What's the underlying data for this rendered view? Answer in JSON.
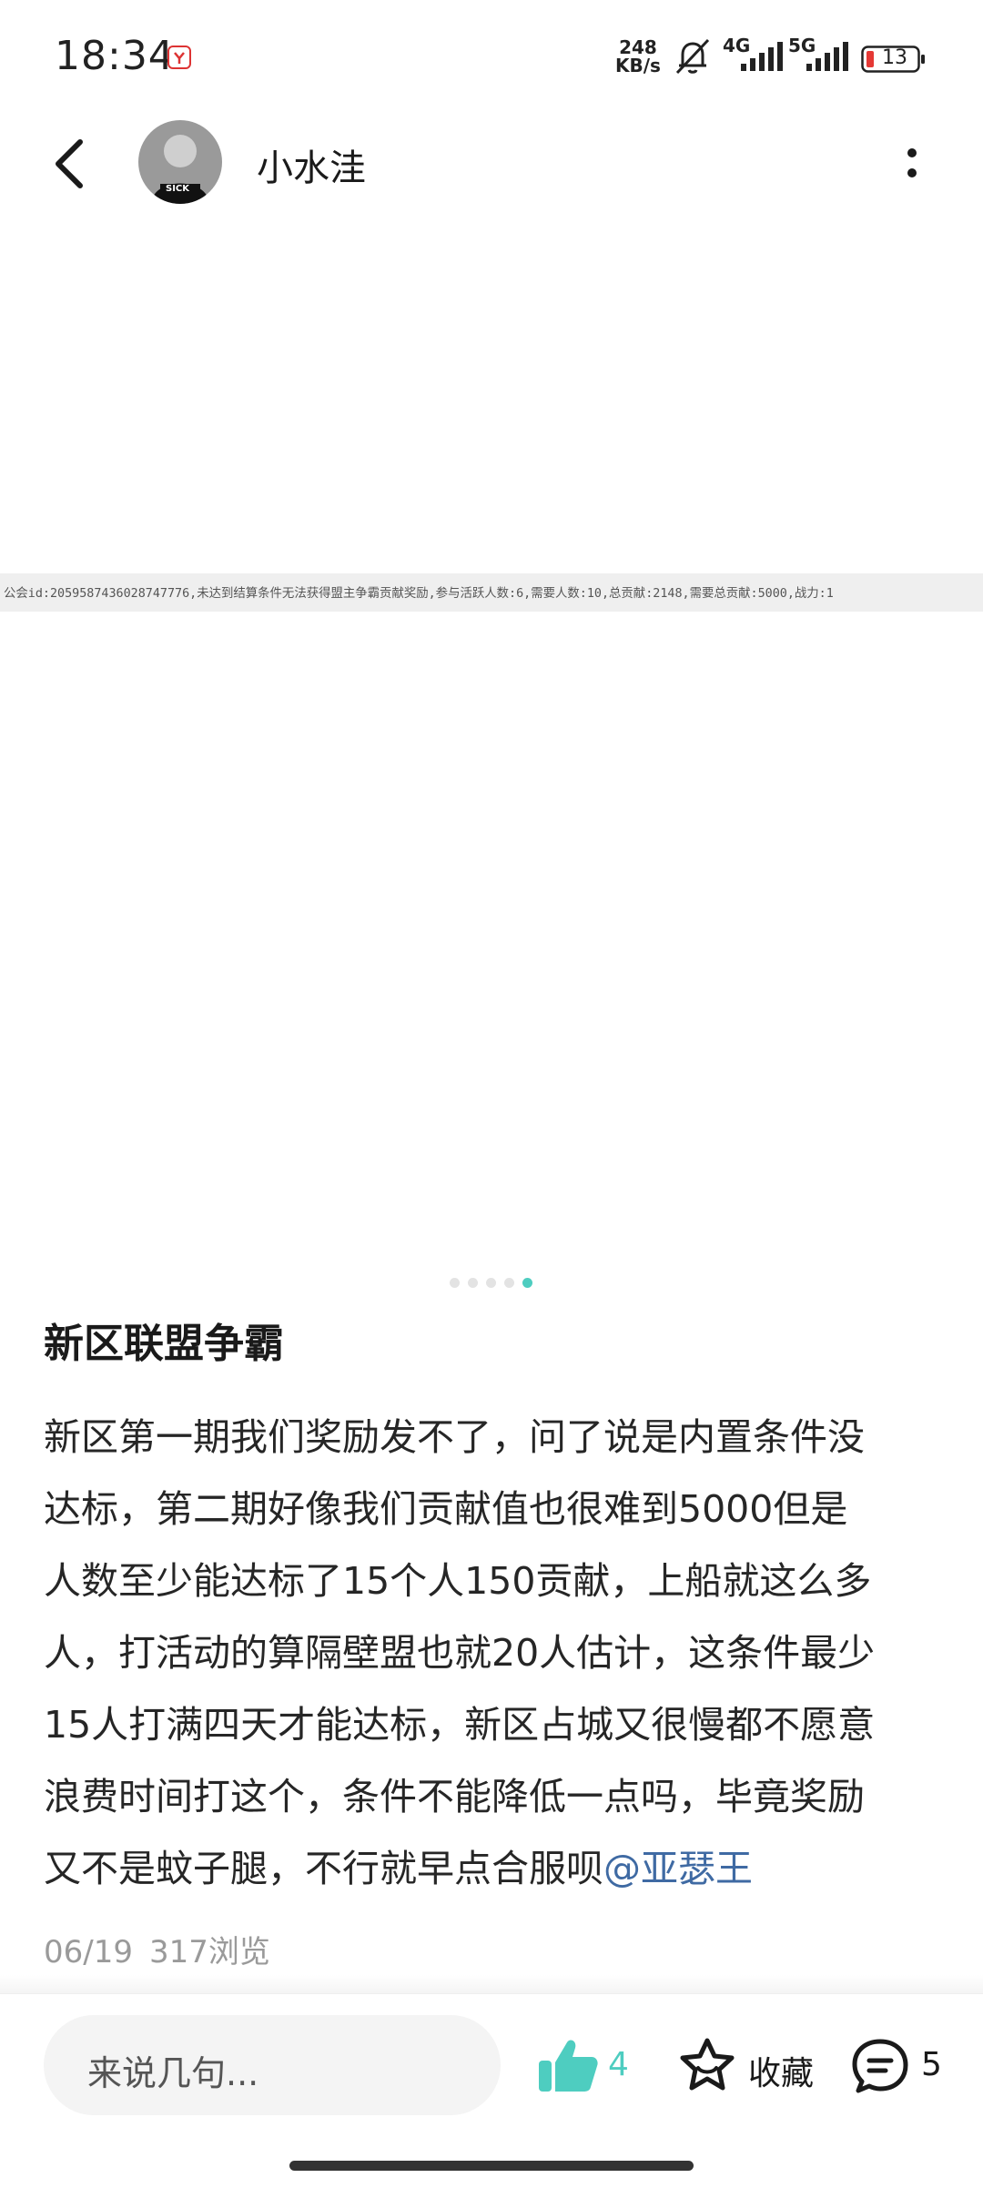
{
  "status_bar": {
    "time": "18:34",
    "net_speed_value": "248",
    "net_speed_unit": "KB/s",
    "signal1_label": "4G",
    "signal2_label": "5G",
    "battery": "13",
    "icons": [
      "app-notification-icon",
      "mute-bell-icon",
      "signal-icon",
      "battery-icon"
    ]
  },
  "header": {
    "username": "小水洼",
    "icons": [
      "back-icon",
      "avatar",
      "more-options-icon"
    ]
  },
  "image": {
    "log_text": "公会id:2059587436028747776,未达到结算条件无法获得盟主争霸贡献奖励,参与活跃人数:6,需要人数:10,总贡献:2148,需要总贡献:5000,战力:1",
    "pager_total": 5,
    "pager_active": 5
  },
  "post": {
    "title": "新区联盟争霸",
    "lines": [
      "新区第一期我们奖励发不了，问了说是内置条件没",
      "达标，第二期好像我们贡献值也很难到5000但是",
      "人数至少能达标了15个人150贡献，上船就这么多",
      "人，打活动的算隔壁盟也就20人估计，这条件最少",
      "15人打满四天才能达标，新区占城又很慢都不愿意",
      "浪费时间打这个，条件不能降低一点吗，毕竟奖励",
      "又不是蚊子腿，不行就早点合服呗"
    ],
    "mention": "@亚瑟王",
    "date": "06/19",
    "views": "317浏览"
  },
  "bottom_bar": {
    "comment_placeholder": "来说几句...",
    "like_count": "4",
    "favorite_label": "收藏",
    "comment_count": "5",
    "accent_color": "#4ecdc0"
  }
}
